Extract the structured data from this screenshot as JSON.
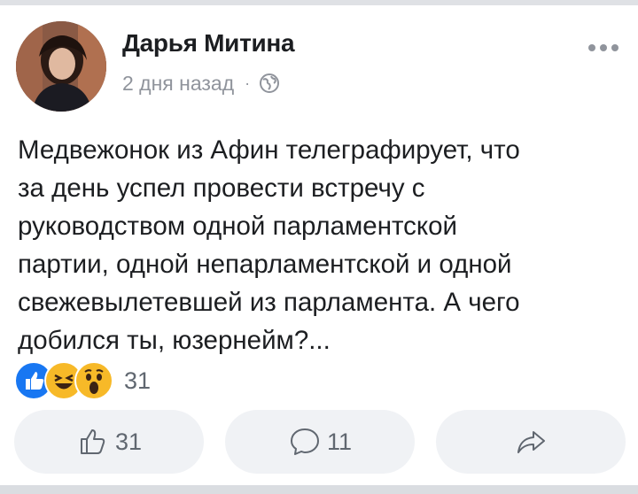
{
  "post": {
    "author_name": "Дарья Митина",
    "time_ago": "2 дня назад",
    "separator": "·",
    "privacy_icon": "globe-icon",
    "more_icon": "more-dots-icon",
    "text": "Медвежонок из Афин телеграфирует,  что\nза день успел провести встречу с\nруководством одной парламентской\nпартии, одной непарламентской и одной\nсвежевылетевшей из парламента.  А чего\nдобился ты, юзернейм?..."
  },
  "reactions": {
    "icons": [
      "like-reaction-icon",
      "haha-reaction-icon",
      "wow-reaction-icon"
    ],
    "count": "31"
  },
  "actions": {
    "like_count": "31",
    "comment_count": "11",
    "like_icon": "thumbs-up-icon",
    "comment_icon": "comment-bubble-icon",
    "share_icon": "share-arrow-icon"
  },
  "colors": {
    "like_blue": "#1877f2",
    "emoji_yellow": "#f7b928",
    "secondary_text": "#90949c",
    "button_bg": "#f0f2f5"
  }
}
